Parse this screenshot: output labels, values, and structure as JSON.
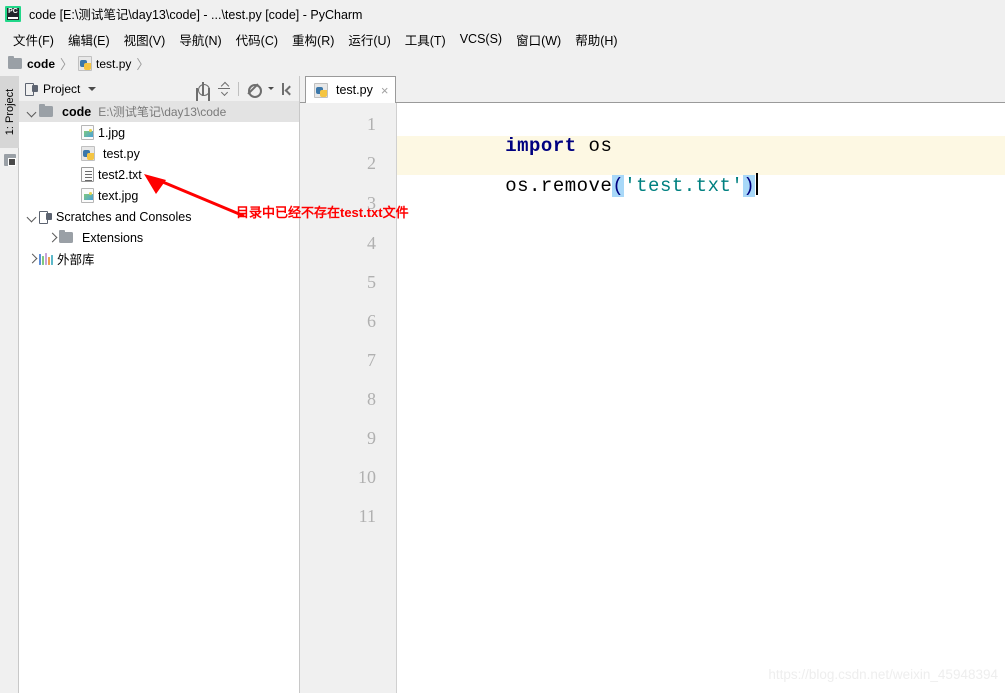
{
  "window": {
    "title": "code [E:\\测试笔记\\day13\\code] - ...\\test.py [code] - PyCharm",
    "app_icon": "pycharm-icon",
    "app_icon_text": "PC"
  },
  "menubar": {
    "items": [
      {
        "label": "文件(F)",
        "mnemonic": "F"
      },
      {
        "label": "编辑(E)",
        "mnemonic": "E"
      },
      {
        "label": "视图(V)",
        "mnemonic": "V"
      },
      {
        "label": "导航(N)",
        "mnemonic": "N"
      },
      {
        "label": "代码(C)",
        "mnemonic": "C"
      },
      {
        "label": "重构(R)",
        "mnemonic": "R"
      },
      {
        "label": "运行(U)",
        "mnemonic": "U"
      },
      {
        "label": "工具(T)",
        "mnemonic": "T"
      },
      {
        "label": "VCS(S)",
        "mnemonic": "S"
      },
      {
        "label": "窗口(W)",
        "mnemonic": "W"
      },
      {
        "label": "帮助(H)",
        "mnemonic": "H"
      }
    ]
  },
  "breadcrumb": {
    "items": [
      {
        "label": "code",
        "icon": "folder-icon"
      },
      {
        "label": "test.py",
        "icon": "python-file-icon"
      }
    ],
    "separator": "〉"
  },
  "left_strip": {
    "project_tab_label": "1: Project",
    "structure_icon": "structure-icon"
  },
  "project_panel": {
    "title": "Project",
    "icon": "project-view-icon",
    "dropdown_icon": "chevron-down-icon",
    "tools": [
      {
        "name": "locate-icon"
      },
      {
        "name": "collapse-all-icon"
      },
      {
        "name": "settings-gear-icon"
      },
      {
        "name": "hide-panel-icon"
      }
    ],
    "tree": [
      {
        "label": "code",
        "path": "E:\\测试笔记\\day13\\code",
        "icon": "folder-icon",
        "arrow": "open",
        "indent": 0,
        "bold": true,
        "selected": true
      },
      {
        "label": "1.jpg",
        "icon": "image-file-icon",
        "arrow": "none",
        "indent": 2,
        "bold": false,
        "selected": false
      },
      {
        "label": "test.py",
        "icon": "python-file-icon",
        "arrow": "none",
        "indent": 2,
        "bold": false,
        "selected": false
      },
      {
        "label": "test2.txt",
        "icon": "text-file-icon",
        "arrow": "none",
        "indent": 2,
        "bold": false,
        "selected": false
      },
      {
        "label": "text.jpg",
        "icon": "image-file-icon",
        "arrow": "none",
        "indent": 2,
        "bold": false,
        "selected": false
      },
      {
        "label": "Scratches and Consoles",
        "icon": "scratches-icon",
        "arrow": "open",
        "indent": 0,
        "bold": false,
        "selected": false
      },
      {
        "label": "Extensions",
        "icon": "folder-icon",
        "arrow": "closed",
        "indent": 1,
        "bold": false,
        "selected": false
      },
      {
        "label": "外部库",
        "icon": "library-icon",
        "arrow": "closed",
        "indent": 0,
        "bold": false,
        "selected": false
      }
    ]
  },
  "annotation": {
    "text": "目录中已经不存在test.txt文件",
    "color": "#ff0000",
    "arrow": "red-arrow-up-left"
  },
  "editor": {
    "tabs": [
      {
        "label": "test.py",
        "icon": "python-file-icon",
        "close_label": "×",
        "active": true
      }
    ],
    "line_numbers": [
      "1",
      "2",
      "3",
      "4",
      "5",
      "6",
      "7",
      "8",
      "9",
      "10",
      "11"
    ],
    "current_line": 2,
    "code_lines": [
      {
        "number": "1",
        "tokens": [
          {
            "text": "import",
            "type": "keyword"
          },
          {
            "text": " os",
            "type": "plain"
          }
        ]
      },
      {
        "number": "2",
        "tokens": [
          {
            "text": "os.remove",
            "type": "plain"
          },
          {
            "text": "(",
            "type": "bracket"
          },
          {
            "text": "'test.txt'",
            "type": "string"
          },
          {
            "text": ")",
            "type": "bracket"
          }
        ]
      }
    ],
    "colors": {
      "keyword": "#000080",
      "string": "#008080",
      "bracket_highlight": "#a8d8f8",
      "current_line_bg": "#fdf8e3",
      "gutter_bg": "#f0f0f0"
    }
  },
  "watermark": {
    "text": "https://blog.csdn.net/weixin_45948394"
  }
}
